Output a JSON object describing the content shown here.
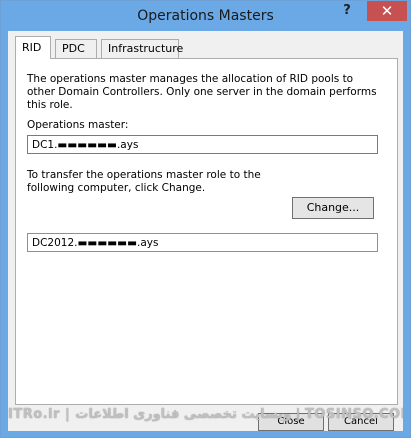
{
  "window": {
    "title": "Operations Masters"
  },
  "titlebar": {
    "help": "?",
    "close": "✕"
  },
  "tabs": [
    {
      "label": "RID",
      "active": true
    },
    {
      "label": "PDC",
      "active": false
    },
    {
      "label": "Infrastructure",
      "active": false
    }
  ],
  "panel": {
    "description": "The operations master manages the allocation of RID pools to other Domain Controllers. Only one server in the domain performs this role.",
    "master_label": "Operations master:",
    "master_value": "DC1.▬▬▬▬▬▬.ays",
    "transfer_text": "To transfer the operations master role to the following computer, click Change.",
    "change_button": "Change...",
    "target_value": "DC2012.▬▬▬▬▬▬.ays"
  },
  "footer": {
    "close_button": "Close",
    "cancel_button": "Cancel",
    "watermark": "ITRo.ir | وبسایت تخصصی فناوری اطلاعات | TOSINSO.COM"
  },
  "colors": {
    "titlebar": "#6aa9e6",
    "close_button": "#c75050",
    "input_focus": "#569de5"
  }
}
